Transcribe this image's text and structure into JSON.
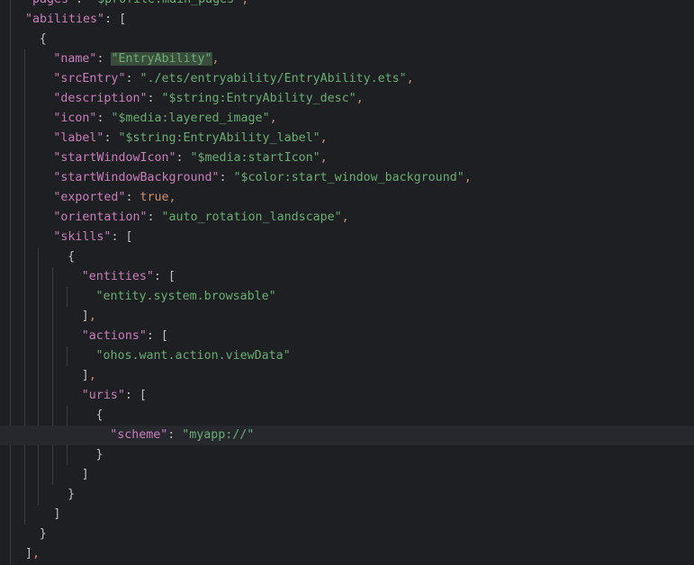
{
  "editor": {
    "lines": [
      {
        "indent": 1,
        "tokens": [
          {
            "t": "k",
            "v": "\"pages\""
          },
          {
            "t": "p",
            "v": ": "
          },
          {
            "t": "s",
            "v": "\"$profile:main_pages\""
          },
          {
            "t": "c",
            "v": ","
          }
        ]
      },
      {
        "indent": 1,
        "tokens": [
          {
            "t": "k",
            "v": "\"abilities\""
          },
          {
            "t": "p",
            "v": ": ["
          }
        ]
      },
      {
        "indent": 2,
        "tokens": [
          {
            "t": "p",
            "v": "{"
          }
        ]
      },
      {
        "indent": 3,
        "tokens": [
          {
            "t": "k",
            "v": "\"name\""
          },
          {
            "t": "p",
            "v": ": "
          },
          {
            "t": "s",
            "v": "\"EntryAbility\"",
            "hl": true
          },
          {
            "t": "c",
            "v": ","
          }
        ]
      },
      {
        "indent": 3,
        "tokens": [
          {
            "t": "k",
            "v": "\"srcEntry\""
          },
          {
            "t": "p",
            "v": ": "
          },
          {
            "t": "s",
            "v": "\"./ets/entryability/EntryAbility.ets\""
          },
          {
            "t": "c",
            "v": ","
          }
        ]
      },
      {
        "indent": 3,
        "tokens": [
          {
            "t": "k",
            "v": "\"description\""
          },
          {
            "t": "p",
            "v": ": "
          },
          {
            "t": "s",
            "v": "\"$string:EntryAbility_desc\""
          },
          {
            "t": "c",
            "v": ","
          }
        ]
      },
      {
        "indent": 3,
        "tokens": [
          {
            "t": "k",
            "v": "\"icon\""
          },
          {
            "t": "p",
            "v": ": "
          },
          {
            "t": "s",
            "v": "\"$media:layered_image\""
          },
          {
            "t": "c",
            "v": ","
          }
        ]
      },
      {
        "indent": 3,
        "tokens": [
          {
            "t": "k",
            "v": "\"label\""
          },
          {
            "t": "p",
            "v": ": "
          },
          {
            "t": "s",
            "v": "\"$string:EntryAbility_label\""
          },
          {
            "t": "c",
            "v": ","
          }
        ]
      },
      {
        "indent": 3,
        "tokens": [
          {
            "t": "k",
            "v": "\"startWindowIcon\""
          },
          {
            "t": "p",
            "v": ": "
          },
          {
            "t": "s",
            "v": "\"$media:startIcon\""
          },
          {
            "t": "c",
            "v": ","
          }
        ]
      },
      {
        "indent": 3,
        "tokens": [
          {
            "t": "k",
            "v": "\"startWindowBackground\""
          },
          {
            "t": "p",
            "v": ": "
          },
          {
            "t": "s",
            "v": "\"$color:start_window_background\""
          },
          {
            "t": "c",
            "v": ","
          }
        ]
      },
      {
        "indent": 3,
        "tokens": [
          {
            "t": "k",
            "v": "\"exported\""
          },
          {
            "t": "p",
            "v": ": "
          },
          {
            "t": "b",
            "v": "true"
          },
          {
            "t": "c",
            "v": ","
          }
        ]
      },
      {
        "indent": 3,
        "tokens": [
          {
            "t": "k",
            "v": "\"orientation\""
          },
          {
            "t": "p",
            "v": ": "
          },
          {
            "t": "s",
            "v": "\"auto_rotation_landscape\""
          },
          {
            "t": "c",
            "v": ","
          }
        ]
      },
      {
        "indent": 3,
        "tokens": [
          {
            "t": "k",
            "v": "\"skills\""
          },
          {
            "t": "p",
            "v": ": ["
          }
        ]
      },
      {
        "indent": 4,
        "tokens": [
          {
            "t": "p",
            "v": "{"
          }
        ]
      },
      {
        "indent": 5,
        "tokens": [
          {
            "t": "k",
            "v": "\"entities\""
          },
          {
            "t": "p",
            "v": ": ["
          }
        ]
      },
      {
        "indent": 6,
        "tokens": [
          {
            "t": "s",
            "v": "\"entity.system.browsable\""
          }
        ]
      },
      {
        "indent": 5,
        "tokens": [
          {
            "t": "p",
            "v": "]"
          },
          {
            "t": "c",
            "v": ","
          }
        ]
      },
      {
        "indent": 5,
        "tokens": [
          {
            "t": "k",
            "v": "\"actions\""
          },
          {
            "t": "p",
            "v": ": ["
          }
        ]
      },
      {
        "indent": 6,
        "tokens": [
          {
            "t": "s",
            "v": "\"ohos.want.action.viewData\""
          }
        ]
      },
      {
        "indent": 5,
        "tokens": [
          {
            "t": "p",
            "v": "]"
          },
          {
            "t": "c",
            "v": ","
          }
        ]
      },
      {
        "indent": 5,
        "tokens": [
          {
            "t": "k",
            "v": "\"uris\""
          },
          {
            "t": "p",
            "v": ": ["
          }
        ]
      },
      {
        "indent": 6,
        "tokens": [
          {
            "t": "p",
            "v": "{"
          }
        ]
      },
      {
        "indent": 7,
        "current": true,
        "tokens": [
          {
            "t": "k",
            "v": "\"scheme\""
          },
          {
            "t": "p",
            "v": ": "
          },
          {
            "t": "s",
            "v": "\"myapp://\""
          }
        ]
      },
      {
        "indent": 6,
        "tokens": [
          {
            "t": "p",
            "v": "}"
          }
        ]
      },
      {
        "indent": 5,
        "tokens": [
          {
            "t": "p",
            "v": "]"
          }
        ]
      },
      {
        "indent": 4,
        "tokens": [
          {
            "t": "p",
            "v": "}"
          }
        ]
      },
      {
        "indent": 3,
        "tokens": [
          {
            "t": "p",
            "v": "]"
          }
        ]
      },
      {
        "indent": 2,
        "tokens": [
          {
            "t": "p",
            "v": "}"
          }
        ]
      },
      {
        "indent": 1,
        "tokens": [
          {
            "t": "p",
            "v": "]"
          },
          {
            "t": "c",
            "v": ","
          }
        ]
      }
    ]
  }
}
